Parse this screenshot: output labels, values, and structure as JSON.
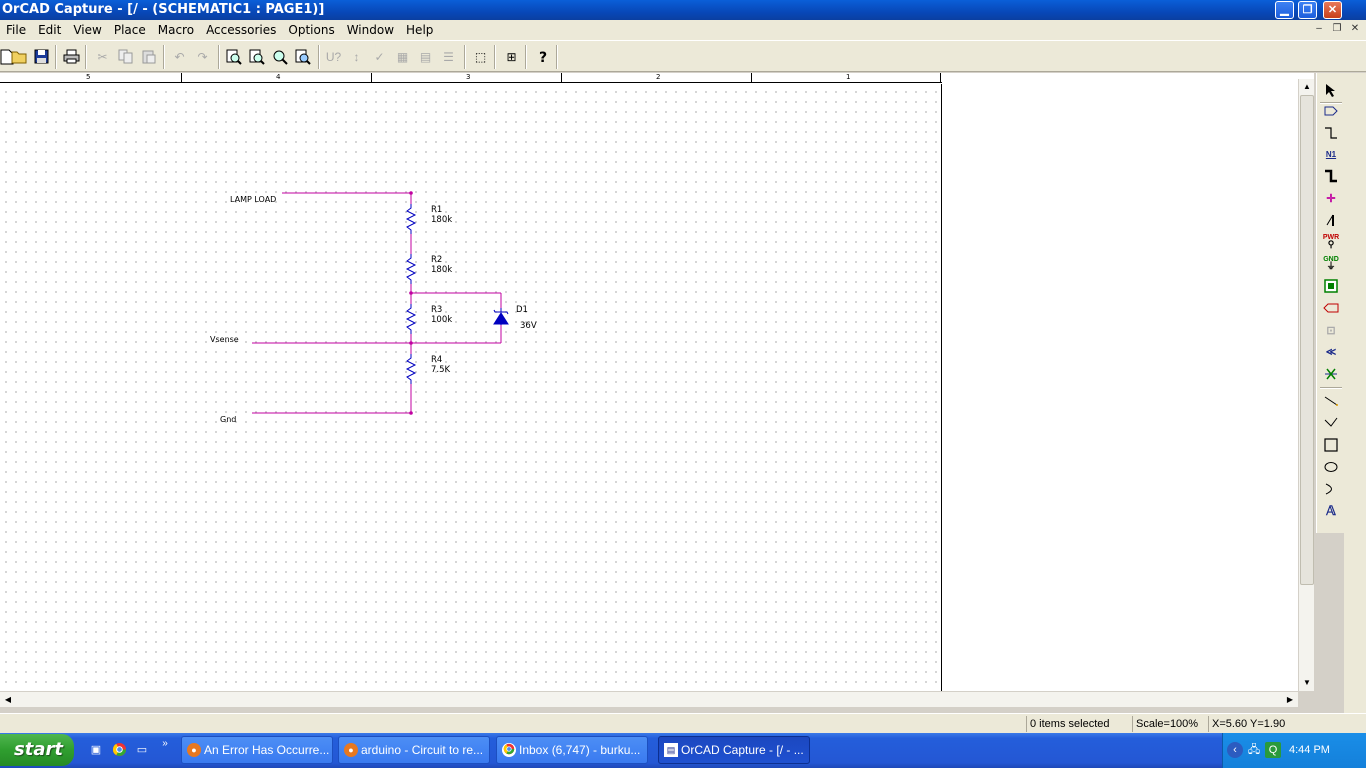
{
  "window": {
    "title": "OrCAD Capture - [/ - (SCHEMATIC1 : PAGE1)]"
  },
  "menu": [
    "File",
    "Edit",
    "View",
    "Place",
    "Macro",
    "Accessories",
    "Options",
    "Window",
    "Help"
  ],
  "ruler": {
    "labels": [
      "5",
      "4",
      "3",
      "2",
      "1"
    ]
  },
  "schematic": {
    "nets": {
      "lamp_load": "LAMP LOAD",
      "vsense": "Vsense",
      "gnd": "Gnd"
    },
    "components": {
      "r1": {
        "ref": "R1",
        "value": "180k"
      },
      "r2": {
        "ref": "R2",
        "value": "180k"
      },
      "r3": {
        "ref": "R3",
        "value": "100k"
      },
      "r4": {
        "ref": "R4",
        "value": "7.5K"
      },
      "d1": {
        "ref": "D1",
        "value": "36V"
      }
    },
    "colors": {
      "wire": "#c000a0",
      "part": "#0000c0",
      "text": "#000000"
    }
  },
  "palette": {
    "pwr_label": "PWR",
    "gnd_label": "GND",
    "net_alias_label": "N1"
  },
  "status": {
    "selection": "0 items selected",
    "scale": "Scale=100%",
    "coords": "X=5.60  Y=1.90"
  },
  "taskbar": {
    "start_label": "start",
    "tasks": [
      "An Error Has Occurre...",
      "arduino - Circuit to re...",
      "Inbox (6,747) - burku...",
      "OrCAD Capture - [/ - ..."
    ],
    "clock": "4:44 PM"
  }
}
